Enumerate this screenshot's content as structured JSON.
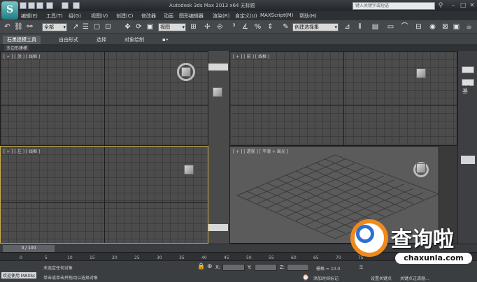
{
  "app": {
    "logo_letter": "S",
    "title": "Autodesk 3ds Max  2013 x64     无标题",
    "search_placeholder": "键入关键字或短语"
  },
  "menu": [
    "编辑(E)",
    "工具(T)",
    "组(G)",
    "视图(V)",
    "创建(C)",
    "修改器",
    "动画",
    "图形编辑器",
    "渲染(R)",
    "自定义(U)",
    "MAXScript(M)",
    "帮助(H)"
  ],
  "toolbar": {
    "selection_filter": "全部",
    "ref_coord": "视图",
    "named_selection": "创建选择集"
  },
  "ribbon": {
    "tabs": [
      "石墨建模工具",
      "自由形式",
      "选择",
      "对象绘制",
      "▪•"
    ],
    "sub_label": "多边形建模"
  },
  "viewports": [
    {
      "label": "[ + ] [ 顶 ] [ 线框 ]"
    },
    {
      "label": "[ + ] [ 前 ] [ 线框 ]"
    },
    {
      "label": "[ + ] [ 左 ] [ 线框 ]"
    },
    {
      "label": "[ + ] [ 透视 ] [ 平滑 + 高光 ]"
    }
  ],
  "cmdpanel": {
    "label": "标准基"
  },
  "timeline": {
    "slider": "0 / 100"
  },
  "ruler_numbers": [
    "0",
    "5",
    "10",
    "15",
    "20",
    "25",
    "30",
    "35",
    "40",
    "45",
    "50",
    "55",
    "60",
    "65",
    "70",
    "75"
  ],
  "status": {
    "welcome": "欢迎使用  MAXSc",
    "line1": "未选定任何对象",
    "line2": "单击或单击并拖动以选择对象",
    "x_label": "X:",
    "y_label": "Y:",
    "z_label": "Z:",
    "grid": "栅格 = 10.0",
    "add_tag": "添加时间标记",
    "set_key": "设置关键点",
    "key_filter": "关键点过滤器..."
  },
  "watermark": {
    "brand": "查询啦",
    "url": "chaxunla.com"
  },
  "colors": {
    "active_viewport_border": "#d0b04a",
    "watermark_orange": "#f08a1c",
    "watermark_blue": "#2f6fd1"
  }
}
